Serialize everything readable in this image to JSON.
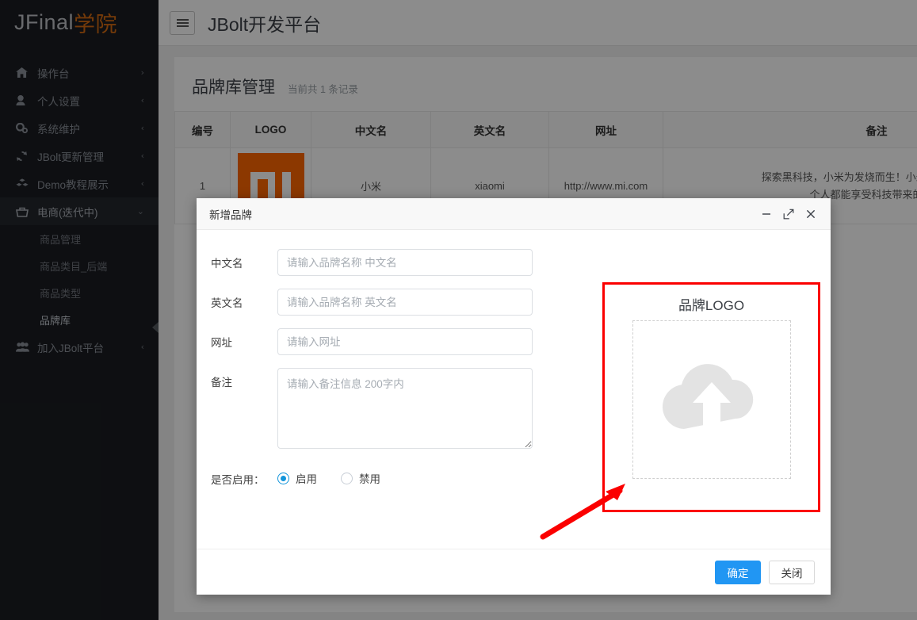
{
  "brand": {
    "part1": "JFinal",
    "part2": "学院"
  },
  "sidebar": {
    "items": [
      {
        "label": "操作台",
        "icon": "home-icon",
        "caret": "›",
        "active": false
      },
      {
        "label": "个人设置",
        "icon": "user-icon",
        "caret": "‹",
        "active": false
      },
      {
        "label": "系统维护",
        "icon": "gears-icon",
        "caret": "‹",
        "active": false
      },
      {
        "label": "JBolt更新管理",
        "icon": "sync-icon",
        "caret": "‹",
        "active": false
      },
      {
        "label": "Demo教程展示",
        "icon": "cubes-icon",
        "caret": "‹",
        "active": false
      },
      {
        "label": "电商(迭代中)",
        "icon": "basket-icon",
        "caret": "⌄",
        "active": true
      }
    ],
    "sub_items": [
      {
        "label": "商品管理",
        "current": false
      },
      {
        "label": "商品类目_后端",
        "current": false
      },
      {
        "label": "商品类型",
        "current": false
      },
      {
        "label": "品牌库",
        "current": true
      }
    ],
    "bottom_item": {
      "label": "加入JBolt平台",
      "icon": "group-icon",
      "caret": "‹"
    }
  },
  "topbar": {
    "menu_toggle": "menu-toggle-icon",
    "app_title": "JBolt开发平台"
  },
  "page": {
    "title": "品牌库管理",
    "record_count": "当前共 1 条记录"
  },
  "table": {
    "headers": [
      "编号",
      "LOGO",
      "中文名",
      "英文名",
      "网址",
      "备注"
    ],
    "rows": [
      {
        "id": "1",
        "logo": "mi-logo",
        "cn_name": "小米",
        "en_name": "xiaomi",
        "url": "http://www.mi.com",
        "remark_line1": "探索黑科技，小米为发烧而生！小米用\"感动人心，",
        "remark_line2": "个人都能享受科技带来的美好"
      }
    ]
  },
  "modal": {
    "title": "新增品牌",
    "window_buttons": [
      {
        "name": "minimize-icon",
        "glyph": "—"
      },
      {
        "name": "maximize-icon",
        "glyph": "⤢"
      },
      {
        "name": "close-icon",
        "glyph": "✕"
      }
    ],
    "fields": [
      {
        "label": "中文名",
        "placeholder": "请输入品牌名称 中文名",
        "type": "text"
      },
      {
        "label": "英文名",
        "placeholder": "请输入品牌名称 英文名",
        "type": "text"
      },
      {
        "label": "网址",
        "placeholder": "请输入网址",
        "type": "text"
      },
      {
        "label": "备注",
        "placeholder": "请输入备注信息 200字内",
        "type": "textarea"
      }
    ],
    "enable": {
      "label": "是否启用：",
      "options": [
        {
          "label": "启用",
          "selected": true
        },
        {
          "label": "禁用",
          "selected": false
        }
      ]
    },
    "logo_panel": {
      "title": "品牌LOGO",
      "upload_icon": "cloud-upload-icon",
      "highlight_color": "#fb0000"
    },
    "buttons": {
      "confirm": "确定",
      "close": "关闭"
    }
  },
  "colors": {
    "sidebar_bg": "#1a1d21",
    "brand_accent": "#d46a12",
    "primary": "#2196f3",
    "annotation_red": "#fb0000",
    "mi_orange": "#ff6700"
  }
}
